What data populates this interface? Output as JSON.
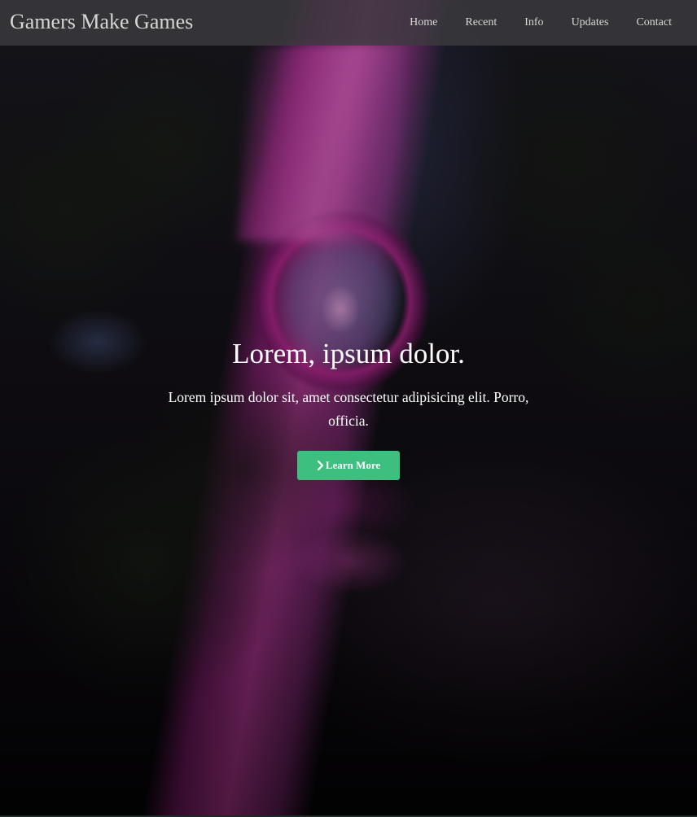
{
  "navbar": {
    "brand": "Gamers Make Games",
    "links": [
      {
        "label": "Home"
      },
      {
        "label": "Recent"
      },
      {
        "label": "Info"
      },
      {
        "label": "Updates"
      },
      {
        "label": "Contact"
      }
    ]
  },
  "hero": {
    "title": "Lorem, ipsum dolor.",
    "subtitle": "Lorem ipsum dolor sit, amet consectetur adipisicing elit. Porro, officia.",
    "button_label": "Learn More",
    "button_icon": "chevron-right-icon",
    "button_color": "#3dc07f",
    "accent_glow_color": "#d43fb4"
  }
}
